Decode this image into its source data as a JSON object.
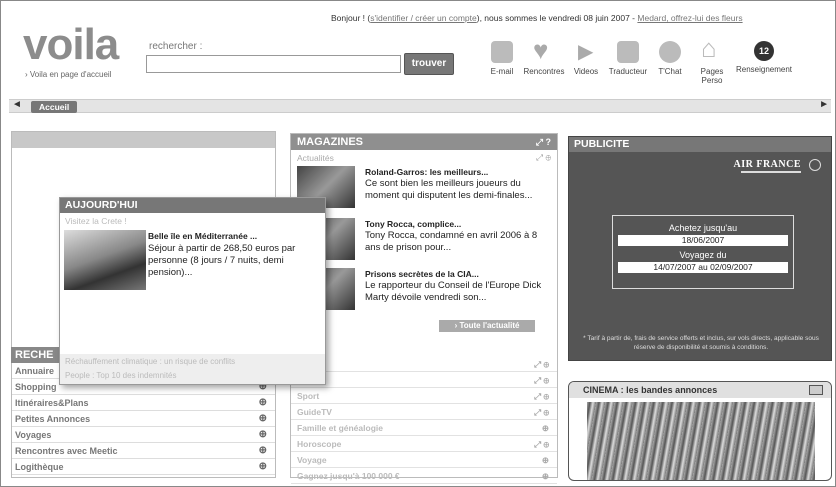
{
  "header": {
    "greeting": "Bonjour ! (",
    "identify_link": "s'identifier / créer un compte",
    "date_text": "), nous sommes le vendredi 08 juin 2007 - ",
    "homepage_link": "Medard, offrez-lui des fleurs",
    "logo": "voila",
    "logo_link": "› Voila en page d'accueil",
    "search_label": "rechercher :",
    "search_value": "",
    "search_button": "trouver"
  },
  "services": [
    {
      "label": "E-mail",
      "icon": "mail-icon"
    },
    {
      "label": "Rencontres",
      "icon": "heart-icon"
    },
    {
      "label": "Videos",
      "icon": "play-icon"
    },
    {
      "label": "Traducteur",
      "icon": "book-icon"
    },
    {
      "label": "T'Chat",
      "icon": "chat-icon"
    },
    {
      "label": "Pages Perso",
      "icon": "home-icon"
    },
    {
      "label": "Renseignement",
      "icon": "renseignement-icon",
      "badge": "12"
    }
  ],
  "nav": {
    "tab": "Accueil"
  },
  "today": {
    "title": "AUJOURD'HUI",
    "subtitle": "Visitez la Crete !",
    "headline": "Belle île en Méditerranée ...",
    "body": "Séjour à partir de 268,50 euros par personne (8 jours / 7 nuits, demi pension)...",
    "links": [
      "Réchauffement climatique : un risque de conflits",
      "People : Top 10 des indemnités"
    ]
  },
  "recherche": {
    "title": "RECHE",
    "items": [
      "Annuaire",
      "Shopping",
      "Itinéraires&Plans",
      "Petites Annonces",
      "Voyages",
      "Rencontres avec Meetic",
      "Logithèque"
    ]
  },
  "magazines": {
    "title": "MAGAZINES",
    "subtitle": "Actualités",
    "articles": [
      {
        "title": "Roland-Garros: les meilleurs...",
        "body": "Ce sont bien les meilleurs joueurs du moment qui disputent les demi-finales..."
      },
      {
        "title": "Tony Rocca, complice...",
        "body": "Tony Rocca, condamné en avril 2006 à 8 ans de prison pour..."
      },
      {
        "title": "Prisons secrètes de la CIA...",
        "body": "Le rapporteur du Conseil de l'Europe Dick Marty dévoile vendredi son..."
      }
    ],
    "all_news": "› Toute l'actualité",
    "list": [
      "",
      "",
      "Sport",
      "GuideTV",
      "Famille et généalogie",
      "Horoscope",
      "Voyage",
      "Gagnez jusqu'à 100 000 €"
    ]
  },
  "publicite": {
    "title": "PUBLICITE",
    "brand": "AIR FRANCE",
    "buy_label": "Achetez jusqu'au",
    "buy_date": "18/06/2007",
    "travel_label": "Voyagez du",
    "travel_dates": "14/07/2007 au 02/09/2007",
    "footnote": "* Tarif à partir de, frais de service offerts et inclus, sur vols directs, applicable sous réserve de disponibilité et soumis à conditions."
  },
  "cinema": {
    "title": "CINEMA : les bandes annonces"
  }
}
